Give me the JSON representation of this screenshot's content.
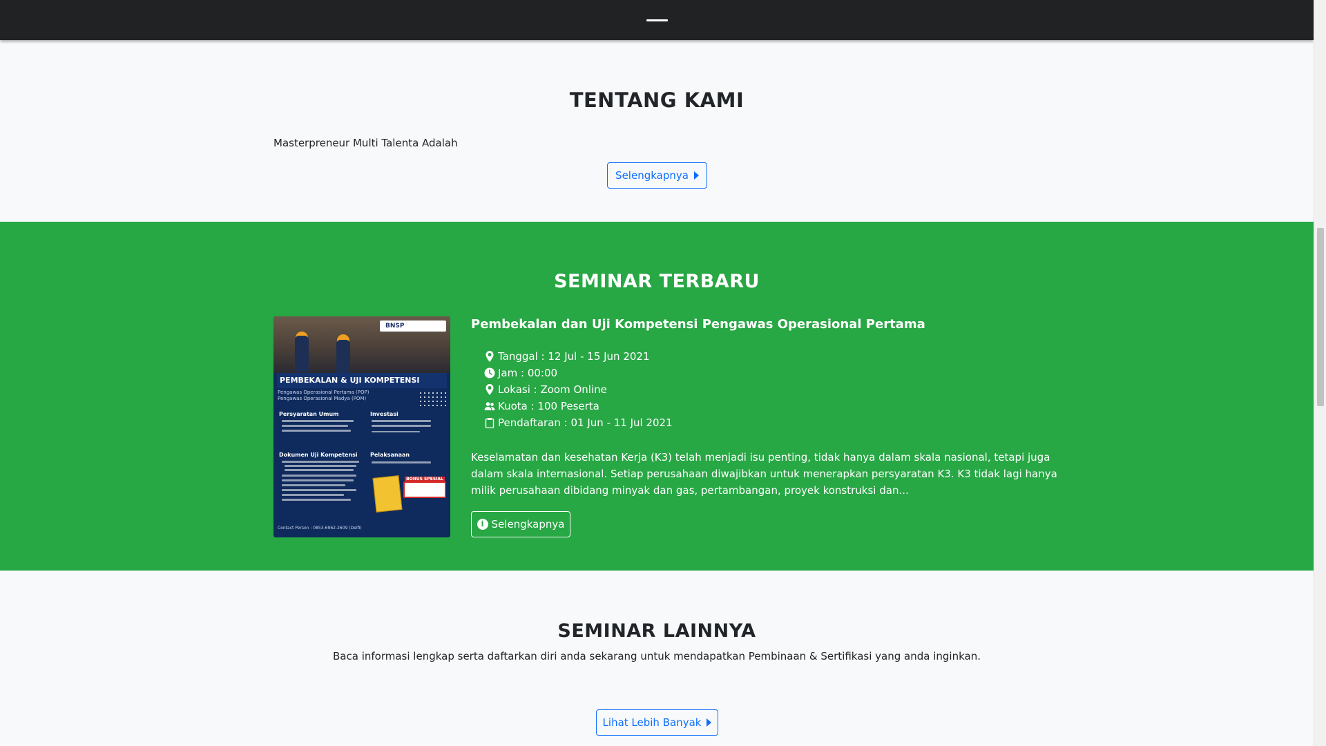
{
  "about": {
    "title": "TENTANG KAMI",
    "text": "Masterpreneur Multi Talenta Adalah",
    "button_label": "Selengkapnya"
  },
  "latest": {
    "title": "SEMINAR TERBARU",
    "poster": {
      "logo_text": "BNSP",
      "headline": "PEMBEKALAN & UJI KOMPETENSI",
      "sub1": "Pengawas Operasional Pertama (POP)",
      "sub2": "Pengawas Operasional Madya (POM)",
      "req_title": "Persyaratan Umum",
      "invest_title": "Investasi",
      "docs_title": "Dokumen Uji Kompetensi",
      "impl_title": "Pelaksanaan",
      "bonus_label": "BONUS SPESIAL",
      "contact": "Contact Person : 0853-6962-2609 (Delfi)"
    },
    "event_title": "Pembekalan dan Uji Kompetensi Pengawas Operasional Pertama",
    "details": {
      "date": "Tanggal : 12 Jul - 15 Jun 2021",
      "time": "Jam : 00:00",
      "location": "Lokasi : Zoom Online",
      "quota": "Kuota : 100 Peserta",
      "registration": "Pendaftaran : 01 Jun - 11 Jul 2021"
    },
    "description": "Keselamatan dan kesehatan Kerja (K3) telah menjadi isu penting, tidak hanya dalam skala nasional, tetapi juga dalam skala internasional. Setiap perusahaan diwajibkan untuk menerapkan persyaratan K3. K3 tidak lagi hanya milik perusahaan dibidang minyak dan gas, pertambangan, proyek konstruksi dan...",
    "button_label": "Selengkapnya"
  },
  "others": {
    "title": "SEMINAR LAINNYA",
    "subtitle": "Baca informasi lengkap serta daftarkan diri anda sekarang untuk mendapatkan Pembinaan & Sertifikasi yang anda inginkan.",
    "button_label": "Lihat Lebih Banyak"
  },
  "colors": {
    "navbar": "#212223",
    "green_section": "#28a745",
    "primary": "#0d6efd",
    "page_bg": "#f8f9fa"
  }
}
